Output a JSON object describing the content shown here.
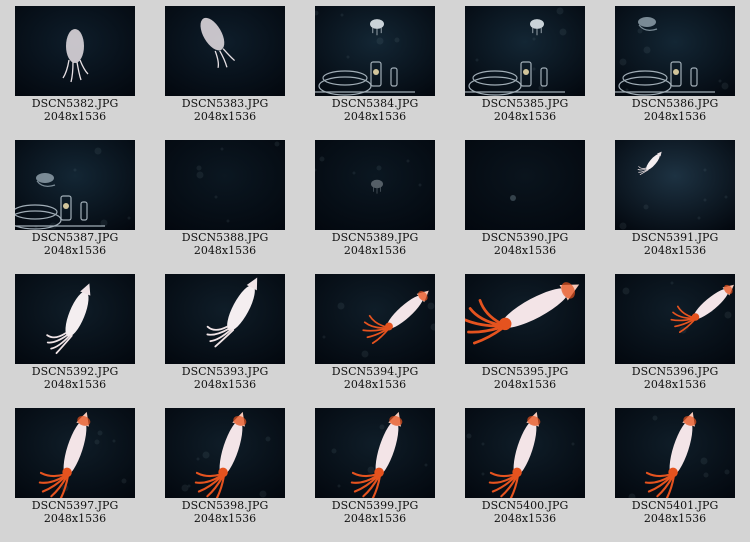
{
  "gallery": {
    "items": [
      {
        "filename": "DSCN5382.JPG",
        "dimensions": "2048x1536",
        "subject": "small-squid-pale"
      },
      {
        "filename": "DSCN5383.JPG",
        "dimensions": "2048x1536",
        "subject": "small-squid-pale"
      },
      {
        "filename": "DSCN5384.JPG",
        "dimensions": "2048x1536",
        "subject": "jellyfish-and-apparatus"
      },
      {
        "filename": "DSCN5385.JPG",
        "dimensions": "2048x1536",
        "subject": "jellyfish-and-apparatus"
      },
      {
        "filename": "DSCN5386.JPG",
        "dimensions": "2048x1536",
        "subject": "ghost-and-apparatus"
      },
      {
        "filename": "DSCN5387.JPG",
        "dimensions": "2048x1536",
        "subject": "ghost-and-apparatus"
      },
      {
        "filename": "DSCN5388.JPG",
        "dimensions": "2048x1536",
        "subject": "dark-water"
      },
      {
        "filename": "DSCN5389.JPG",
        "dimensions": "2048x1536",
        "subject": "dark-faint-jelly"
      },
      {
        "filename": "DSCN5390.JPG",
        "dimensions": "2048x1536",
        "subject": "dark-faint-speck"
      },
      {
        "filename": "DSCN5391.JPG",
        "dimensions": "2048x1536",
        "subject": "tiny-white-squid"
      },
      {
        "filename": "DSCN5392.JPG",
        "dimensions": "2048x1536",
        "subject": "white-squid"
      },
      {
        "filename": "DSCN5393.JPG",
        "dimensions": "2048x1536",
        "subject": "white-squid"
      },
      {
        "filename": "DSCN5394.JPG",
        "dimensions": "2048x1536",
        "subject": "red-squid"
      },
      {
        "filename": "DSCN5395.JPG",
        "dimensions": "2048x1536",
        "subject": "red-squid-large"
      },
      {
        "filename": "DSCN5396.JPG",
        "dimensions": "2048x1536",
        "subject": "red-squid"
      },
      {
        "filename": "DSCN5397.JPG",
        "dimensions": "2048x1536",
        "subject": "red-squid-vertical"
      },
      {
        "filename": "DSCN5398.JPG",
        "dimensions": "2048x1536",
        "subject": "red-squid-vertical"
      },
      {
        "filename": "DSCN5399.JPG",
        "dimensions": "2048x1536",
        "subject": "red-squid-vertical"
      },
      {
        "filename": "DSCN5400.JPG",
        "dimensions": "2048x1536",
        "subject": "red-squid-vertical"
      },
      {
        "filename": "DSCN5401.JPG",
        "dimensions": "2048x1536",
        "subject": "red-squid-vertical"
      }
    ]
  },
  "colors": {
    "background": "#d4d4d4",
    "photo_water": "#06111b",
    "squid_body": "#f3e4e7",
    "squid_red": "#e5531f",
    "text": "#111111"
  }
}
